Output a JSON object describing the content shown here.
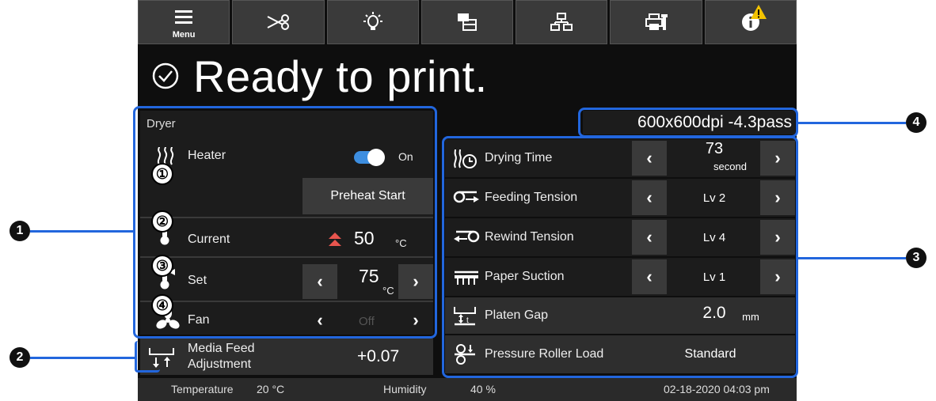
{
  "toolbar": {
    "menu_label": "Menu",
    "icons": [
      "menu-icon",
      "scissors-icon",
      "lamp-icon",
      "media-icon",
      "network-icon",
      "printer-maintenance-icon",
      "info-icon"
    ],
    "warning_icon": "warning-icon"
  },
  "status": {
    "text": "Ready to print."
  },
  "dryer": {
    "title": "Dryer",
    "heater_label": "Heater",
    "heater_state": "On",
    "preheat_label": "Preheat Start",
    "current_label": "Current",
    "current_value": "50",
    "current_unit": "°C",
    "set_label": "Set",
    "set_value": "75",
    "set_unit": "°C",
    "fan_label": "Fan",
    "fan_value": "Off",
    "markers": [
      "①",
      "②",
      "③",
      "④"
    ]
  },
  "media_feed": {
    "label_line1": "Media Feed",
    "label_line2": "Adjustment",
    "value": "+0.07"
  },
  "print_mode": "600x600dpi -4.3pass",
  "settings": {
    "drying_time_label": "Drying Time",
    "drying_time_value": "73",
    "drying_time_unit": "second",
    "feeding_tension_label": "Feeding Tension",
    "feeding_tension_value": "Lv 2",
    "rewind_tension_label": "Rewind Tension",
    "rewind_tension_value": "Lv 4",
    "paper_suction_label": "Paper Suction",
    "paper_suction_value": "Lv 1",
    "platen_gap_label": "Platen Gap",
    "platen_gap_value": "2.0",
    "platen_gap_unit": "mm",
    "pressure_roller_label": "Pressure Roller Load",
    "pressure_roller_value": "Standard"
  },
  "footer": {
    "temperature_label": "Temperature",
    "temperature_value": "20 °C",
    "humidity_label": "Humidity",
    "humidity_value": "40 %",
    "datetime": "02-18-2020 04:03 pm"
  },
  "callouts": [
    "1",
    "2",
    "3",
    "4"
  ],
  "colors": {
    "accent_blue": "#2266dd",
    "toggle_on": "#3d8ee0",
    "background": "#0e0e0e"
  }
}
